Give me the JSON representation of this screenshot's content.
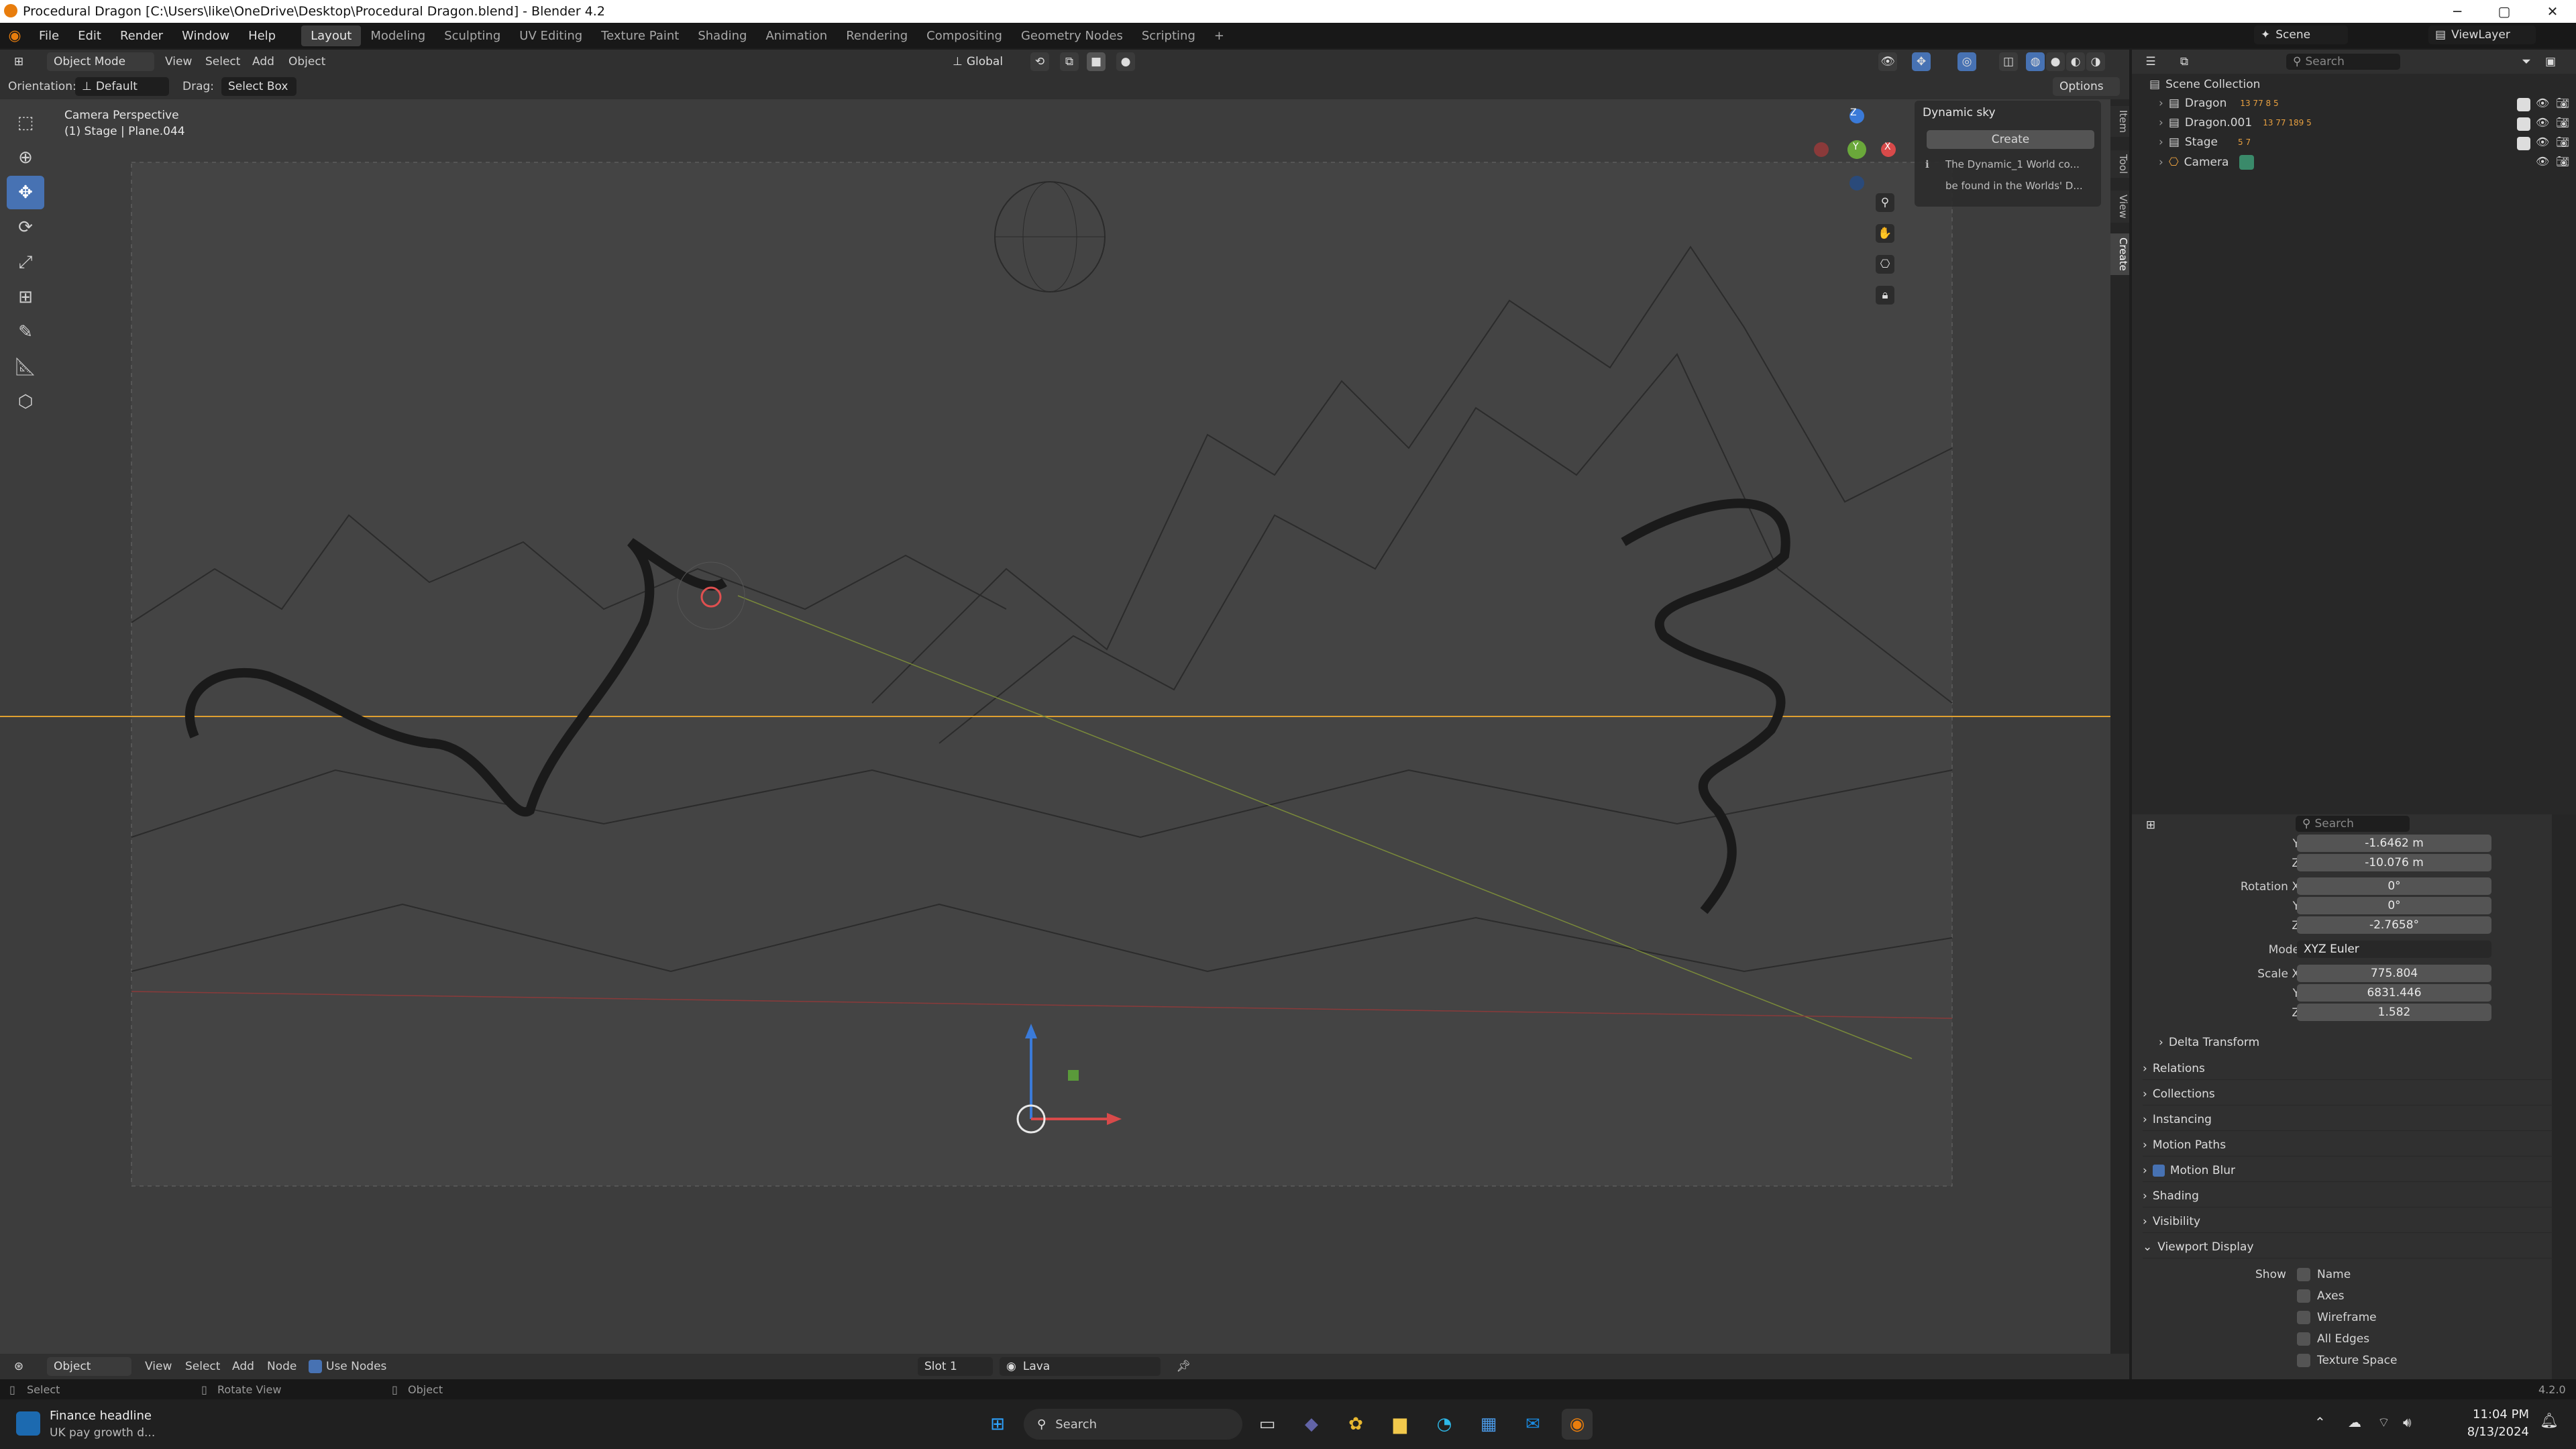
{
  "window": {
    "title": "Procedural Dragon [C:\\Users\\like\\OneDrive\\Desktop\\Procedural Dragon.blend] - Blender 4.2",
    "minimize": "─",
    "maximize": "▢",
    "close": "✕"
  },
  "menu": {
    "items": [
      "File",
      "Edit",
      "Render",
      "Window",
      "Help"
    ],
    "workspaces": [
      "Layout",
      "Modeling",
      "Sculpting",
      "UV Editing",
      "Texture Paint",
      "Shading",
      "Animation",
      "Rendering",
      "Compositing",
      "Geometry Nodes",
      "Scripting",
      "+"
    ],
    "scene_label": "Scene",
    "viewlayer_label": "ViewLayer"
  },
  "header": {
    "mode": "Object Mode",
    "view": "View",
    "select": "Select",
    "add": "Add",
    "object": "Object",
    "transform": "Global",
    "options": "Options",
    "search_placeholder": "Search"
  },
  "header2": {
    "orientation_label": "Orientation:",
    "orientation_value": "Default",
    "drag_label": "Drag:",
    "drag_value": "Select Box"
  },
  "viewport": {
    "camera_title": "Camera Perspective",
    "camera_sub": "(1) Stage | Plane.044",
    "gizmo": {
      "x": "X",
      "y": "Y",
      "z": "Z"
    }
  },
  "npanel": {
    "title": "Dynamic sky",
    "create_btn": "Create",
    "info1": "The Dynamic_1 World co...",
    "info2": "be found in the Worlds' D...",
    "tabs": [
      "Item",
      "Tool",
      "View",
      "Create"
    ]
  },
  "outliner": {
    "search_placeholder": "Search",
    "root": "Scene Collection",
    "items": [
      {
        "name": "Dragon",
        "badges": "13  77 8 5"
      },
      {
        "name": "Dragon.001",
        "badges": "13 77 189 5"
      },
      {
        "name": "Stage",
        "badges": "5 7"
      },
      {
        "name": "Camera",
        "badges": ""
      }
    ]
  },
  "properties": {
    "search_placeholder": "Search",
    "rows": [
      {
        "k": "Y",
        "v": "-1.6462 m"
      },
      {
        "k": "Z",
        "v": "-10.076 m"
      },
      {
        "k": "Rotation X",
        "v": "0°"
      },
      {
        "k": "Y",
        "v": "0°"
      },
      {
        "k": "Z",
        "v": "-2.7658°"
      },
      {
        "k": "Mode",
        "v": "XYZ Euler"
      },
      {
        "k": "Scale X",
        "v": "775.804"
      },
      {
        "k": "Y",
        "v": "6831.446"
      },
      {
        "k": "Z",
        "v": "1.582"
      }
    ],
    "delta": "Delta Transform",
    "panels": [
      "Relations",
      "Collections",
      "Instancing",
      "Motion Paths",
      "Motion Blur",
      "Shading",
      "Visibility",
      "Viewport Display"
    ],
    "show_label": "Show",
    "show_items": [
      "Name",
      "Axes",
      "Wireframe",
      "All Edges",
      "Texture Space"
    ]
  },
  "footer": {
    "editor": "Object",
    "view": "View",
    "select": "Select",
    "add": "Add",
    "node": "Node",
    "use_nodes": "Use Nodes",
    "slot": "Slot 1",
    "material": "Lava"
  },
  "status": {
    "select": "Select",
    "rotate": "Rotate View",
    "object": "Object",
    "version": "4.2.0"
  },
  "taskbar": {
    "news_title": "Finance headline",
    "news_sub": "UK pay growth d...",
    "search_placeholder": "Search",
    "time": "11:04 PM",
    "date": "8/13/2024"
  },
  "colors": {
    "accent": "#4772b3",
    "viewport": "#3d3d3d",
    "panel": "#303030"
  }
}
